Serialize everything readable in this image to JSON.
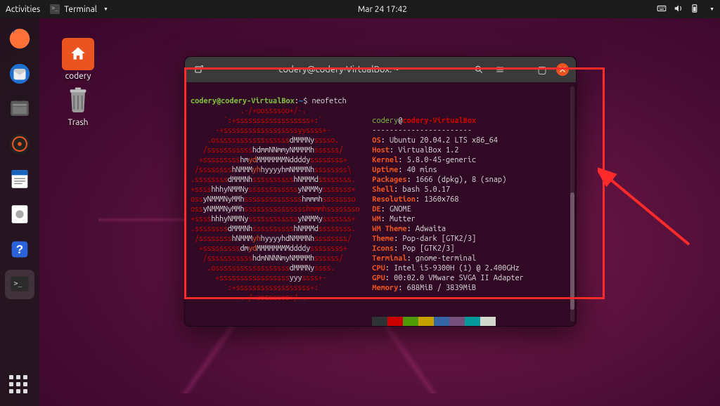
{
  "topbar": {
    "activities": "Activities",
    "app": "Terminal",
    "clock": "Mar 24  17:42"
  },
  "desktop": {
    "home": "codery",
    "trash": "Trash"
  },
  "term": {
    "title": "codery@codery-VirtualBox: ~",
    "prompt_user": "codery@codery-VirtualBox",
    "prompt_path": "~",
    "prompt_sym": "$",
    "cmd": "neofetch"
  },
  "neofetch": {
    "user": "codery",
    "at": "@",
    "host": "codery-VirtualBox",
    "dash": "-----------------------",
    "fields": [
      {
        "k": "OS",
        "v": "Ubuntu 20.04.2 LTS x86_64"
      },
      {
        "k": "Host",
        "v": "VirtualBox 1.2"
      },
      {
        "k": "Kernel",
        "v": "5.8.0-45-generic"
      },
      {
        "k": "Uptime",
        "v": "40 mins"
      },
      {
        "k": "Packages",
        "v": "1666 (dpkg), 8 (snap)"
      },
      {
        "k": "Shell",
        "v": "bash 5.0.17"
      },
      {
        "k": "Resolution",
        "v": "1360x768"
      },
      {
        "k": "DE",
        "v": "GNOME"
      },
      {
        "k": "WM",
        "v": "Mutter"
      },
      {
        "k": "WM Theme",
        "v": "Adwaita"
      },
      {
        "k": "Theme",
        "v": "Pop-dark [GTK2/3]"
      },
      {
        "k": "Icons",
        "v": "Pop [GTK2/3]"
      },
      {
        "k": "Terminal",
        "v": "gnome-terminal"
      },
      {
        "k": "CPU",
        "v": "Intel i5-9300H (1) @ 2.400GHz"
      },
      {
        "k": "GPU",
        "v": "00:02.0 VMware SVGA II Adapter"
      },
      {
        "k": "Memory",
        "v": "688MiB / 3839MiB"
      }
    ],
    "swatches1": [
      "#2e3436",
      "#cc0000",
      "#4e9a06",
      "#c4a000",
      "#3465a4",
      "#75507b",
      "#06989a",
      "#d3d7cf"
    ],
    "swatches2": [
      "#555753",
      "#555753",
      "#555753",
      "#555753",
      "#555753",
      "#555753",
      "#555753",
      "#555753"
    ],
    "ascii": [
      "            .-/+oossssoo+/-.",
      "        `:+ssssssssssssssssss+:`",
      "      -+ssssssssssssssssssyyssss+-",
      "    .ossssssssssssssssss<w>dMMMNy</w>sssso.",
      "   /sssssssssss<w>hdmmNNmmyNMMMMh</w>ssssss/",
      "  +sssssssss<w>hm</w><y>yd</y><w>MMMMMMMNddddy</w>ssssssss+",
      " /ssssssss<w>hNMMM</w><y>yh</y><w>hyyyyhmNMMMNh</w>ssssssss\\",
      ".ssssssss<w>dMMMNh</w>ssssssssss<w>hNMMMd</w>ssssssss.",
      "+ssss<w>hhhyNMMNy</w>ssssssssssss<w>yNMMMy</w>sssssss+",
      "oss<w>yNMMMNyMMh</w>ssssssssssssss<w>hmmmh</w>ssssssso",
      "oss<w>yNMMMNyMMh</w>ssssssssssssssshmmmhssssssso",
      "+ssss<w>hhhyNMMNy</w>ssssssssssss<w>yNMMMy</w>sssssss+",
      ".ssssssss<w>dMMMNh</w>ssssssssss<w>hNMMMd</w>ssssssss.",
      " /ssssssss<w>hNMMM</w><y>yh</y><w>hyyyyhdNMMMNh</w>ssssssss/",
      "  +sssssssss<w>dm</w><y>yd</y><w>MMMMMMMMddddy</w>ssssssss+",
      "   /sssssssssss<w>hdmNNNNmyNMMMMh</w>ssssss/",
      "    .ossssssssssssssssss<w>dMMMNy</w>ssss.",
      "      +sssssssssssssssss<w>yyy</w>ssss+-",
      "        `:+ssssssssssssssssss+:`",
      "            .-/+oossssoo+/-."
    ]
  }
}
